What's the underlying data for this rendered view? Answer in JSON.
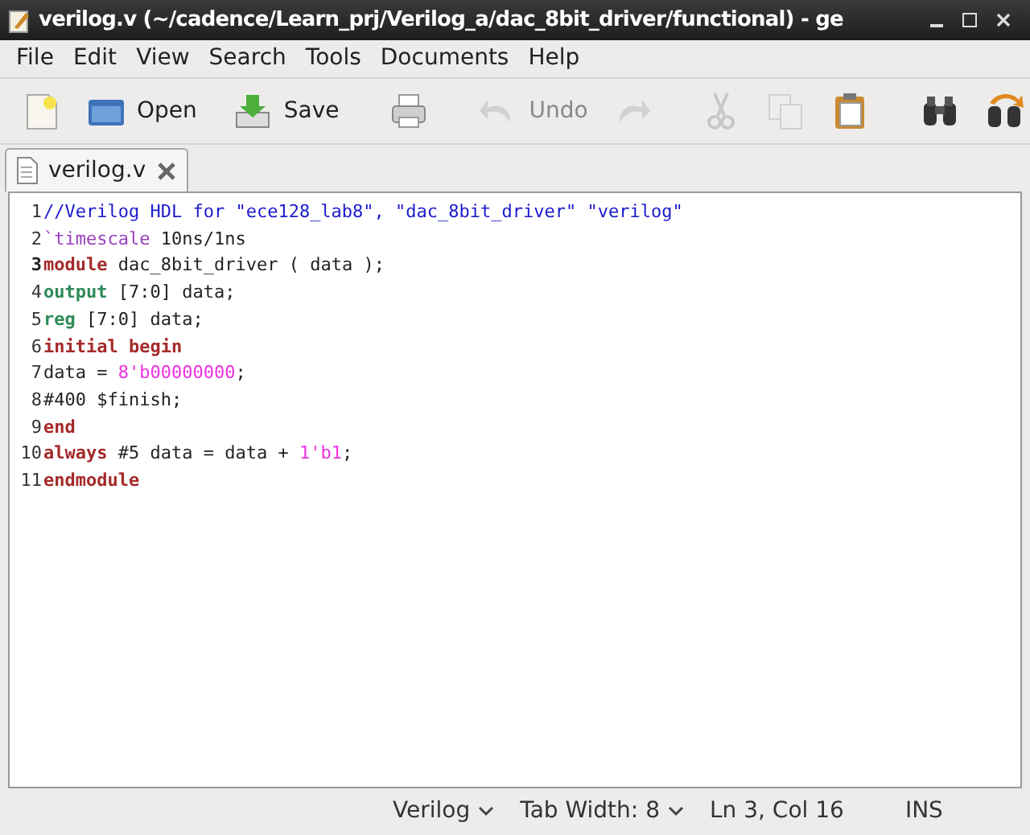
{
  "window": {
    "title": "verilog.v (~/cadence/Learn_prj/Verilog_a/dac_8bit_driver/functional) - ge"
  },
  "menu": [
    "File",
    "Edit",
    "View",
    "Search",
    "Tools",
    "Documents",
    "Help"
  ],
  "toolbar": [
    {
      "kind": "new",
      "disabled": false
    },
    {
      "kind": "open",
      "label": "Open",
      "disabled": false
    },
    {
      "kind": "save",
      "label": "Save",
      "disabled": false
    },
    {
      "kind": "sep"
    },
    {
      "kind": "print",
      "disabled": false
    },
    {
      "kind": "sep"
    },
    {
      "kind": "undo",
      "label": "Undo",
      "disabled": true
    },
    {
      "kind": "redo",
      "disabled": true
    },
    {
      "kind": "sep"
    },
    {
      "kind": "cut",
      "disabled": true
    },
    {
      "kind": "copy",
      "disabled": true
    },
    {
      "kind": "paste",
      "disabled": false
    },
    {
      "kind": "sep"
    },
    {
      "kind": "find",
      "disabled": false
    },
    {
      "kind": "replace",
      "disabled": false
    }
  ],
  "tabs": [
    {
      "label": "verilog.v",
      "selected": true
    }
  ],
  "editor": {
    "lines": [
      {
        "number": "1",
        "current": false,
        "tokens": [
          {
            "kind": "comment",
            "text": "//Verilog HDL for \"ece128_lab8\", \"dac_8bit_driver\" \"verilog\""
          }
        ]
      },
      {
        "number": "2",
        "current": false,
        "tokens": [
          {
            "kind": "preproc",
            "text": "`timescale"
          },
          {
            "kind": "plain",
            "text": " 10ns/1ns"
          }
        ]
      },
      {
        "number": "3",
        "current": true,
        "tokens": [
          {
            "kind": "keyword",
            "text": "module"
          },
          {
            "kind": "plain",
            "text": " dac_8bit_driver ( data );"
          }
        ]
      },
      {
        "number": "4",
        "current": false,
        "tokens": [
          {
            "kind": "type",
            "text": "output"
          },
          {
            "kind": "plain",
            "text": " [7:0] data;"
          }
        ]
      },
      {
        "number": "5",
        "current": false,
        "tokens": [
          {
            "kind": "type",
            "text": "reg"
          },
          {
            "kind": "plain",
            "text": " [7:0] data;"
          }
        ]
      },
      {
        "number": "6",
        "current": false,
        "tokens": [
          {
            "kind": "keyword",
            "text": "initial begin"
          }
        ]
      },
      {
        "number": "7",
        "current": false,
        "tokens": [
          {
            "kind": "plain",
            "text": "data = "
          },
          {
            "kind": "number",
            "text": "8'b00000000"
          },
          {
            "kind": "plain",
            "text": ";"
          }
        ]
      },
      {
        "number": "8",
        "current": false,
        "tokens": [
          {
            "kind": "plain",
            "text": "#400 $finish;"
          }
        ]
      },
      {
        "number": "9",
        "current": false,
        "tokens": [
          {
            "kind": "keyword",
            "text": "end"
          }
        ]
      },
      {
        "number": "10",
        "current": false,
        "tokens": [
          {
            "kind": "keyword",
            "text": "always"
          },
          {
            "kind": "plain",
            "text": " #5 data = data + "
          },
          {
            "kind": "number",
            "text": "1'b1"
          },
          {
            "kind": "plain",
            "text": ";"
          }
        ]
      },
      {
        "number": "11",
        "current": false,
        "tokens": [
          {
            "kind": "keyword",
            "text": "endmodule"
          }
        ]
      }
    ]
  },
  "status_bar": {
    "language": "Verilog",
    "tab_width": "Tab Width:  8",
    "position": "Ln 3, Col 16",
    "mode": "INS"
  }
}
